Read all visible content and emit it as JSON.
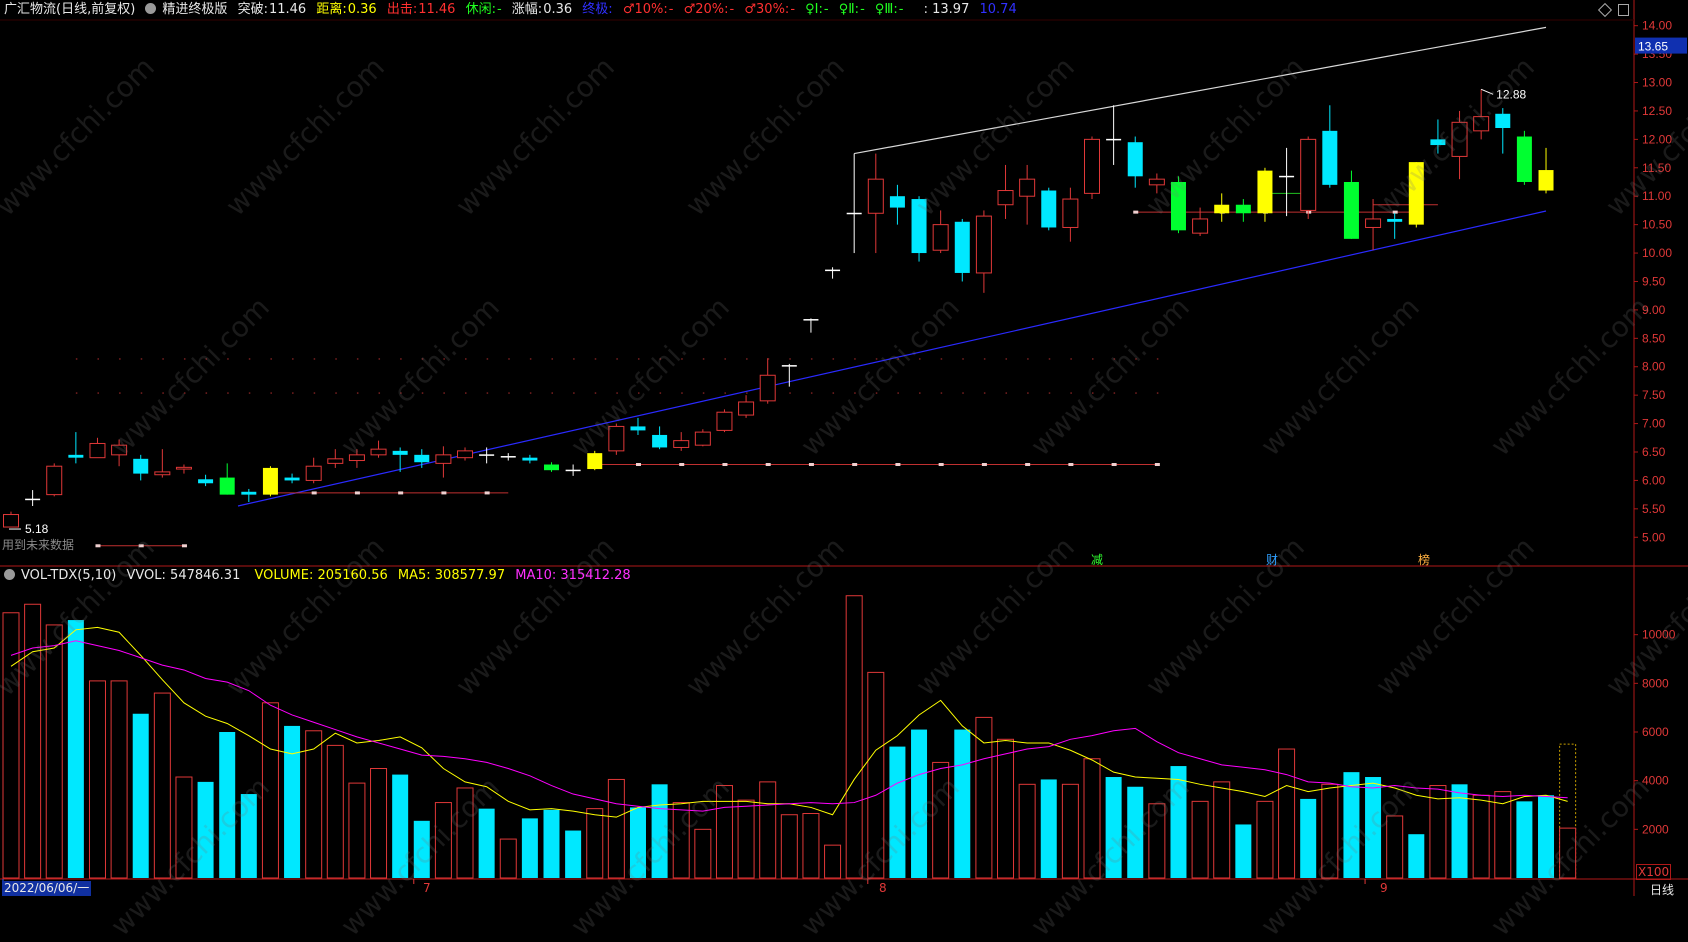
{
  "header": {
    "stock_title": "广汇物流(日线,前复权)",
    "indicator_name": "精进终极版",
    "tupo_label": "突破:",
    "tupo_value": "11.46",
    "juli_label": "距离:",
    "juli_value": "0.36",
    "chuji_label": "出击:",
    "chuji_value": "11.46",
    "xiuxian_label": "休闲:",
    "xiuxian_value": "-",
    "zhangfu_label": "涨幅:",
    "zhangfu_value": "0.36",
    "zhongji_label": "终极:",
    "p10_label": "♂10%:",
    "p10_value": "-",
    "p20_label": "♂20%:",
    "p20_value": "-",
    "p30_label": "♂30%:",
    "p30_value": "-",
    "q1_label": "♀Ⅰ:",
    "q1_value": "-",
    "q2_label": "♀Ⅱ:",
    "q2_value": "-",
    "q3_label": "♀Ⅲ:",
    "q3_value": "-",
    "v1": ": 13.97",
    "v2": "10.74"
  },
  "volume_header": {
    "name": "VOL-TDX(5,10)",
    "vvol": "VVOL: 547846.31",
    "volume": "VOLUME: 205160.56",
    "ma5": "MA5: 308577.97",
    "ma10": "MA10: 315412.28"
  },
  "colors": {
    "up": "#e03838",
    "down": "#00e8ff",
    "yellow": "#ffff00",
    "green": "#00ff30",
    "white": "#ffffff",
    "blue": "#2020ff",
    "magenta": "#ff00ff",
    "axis": "#b01818"
  },
  "watermark": "www.cfchi.com",
  "future_data_text": "用到未来数据",
  "event_markers": [
    "减",
    "财",
    "榜"
  ],
  "bottom_axis": {
    "start_date": "2022/06/06/一",
    "months": [
      "7",
      "8",
      "9"
    ],
    "period": "日线"
  },
  "volume_unit": "X100",
  "chart_data": [
    {
      "type": "candlestick",
      "title": "广汇物流(日线,前复权)",
      "y_ticks": [
        "14.00",
        "13.50",
        "13.00",
        "12.50",
        "12.00",
        "11.50",
        "11.00",
        "10.50",
        "10.00",
        "9.50",
        "9.00",
        "8.50",
        "8.00",
        "7.50",
        "7.00",
        "6.50",
        "6.00",
        "5.50",
        "5.00"
      ],
      "ylim": [
        4.6,
        14.1
      ],
      "current_price_label": "13.65",
      "annotations": [
        {
          "text": "12.88",
          "kind": "high"
        },
        {
          "text": "5.18",
          "kind": "low"
        }
      ],
      "candles": [
        {
          "o": 5.18,
          "h": 5.45,
          "l": 5.18,
          "c": 5.4,
          "t": "up"
        },
        {
          "o": 5.67,
          "h": 5.83,
          "l": 5.55,
          "c": 5.66,
          "t": "doji"
        },
        {
          "o": 5.75,
          "h": 6.3,
          "l": 5.72,
          "c": 6.25,
          "t": "up"
        },
        {
          "o": 6.45,
          "h": 6.85,
          "l": 6.3,
          "c": 6.4,
          "t": "down"
        },
        {
          "o": 6.4,
          "h": 6.75,
          "l": 6.4,
          "c": 6.65,
          "t": "up"
        },
        {
          "o": 6.62,
          "h": 6.72,
          "l": 6.25,
          "c": 6.45,
          "t": "up"
        },
        {
          "o": 6.38,
          "h": 6.45,
          "l": 6.0,
          "c": 6.12,
          "t": "down"
        },
        {
          "o": 6.1,
          "h": 6.55,
          "l": 6.05,
          "c": 6.15,
          "t": "up"
        },
        {
          "o": 6.2,
          "h": 6.28,
          "l": 6.12,
          "c": 6.23,
          "t": "up"
        },
        {
          "o": 6.02,
          "h": 6.1,
          "l": 5.9,
          "c": 5.95,
          "t": "down"
        },
        {
          "o": 6.05,
          "h": 6.3,
          "l": 5.75,
          "c": 5.75,
          "t": "green"
        },
        {
          "o": 5.8,
          "h": 5.85,
          "l": 5.62,
          "c": 5.75,
          "t": "down"
        },
        {
          "o": 5.75,
          "h": 6.25,
          "l": 5.72,
          "c": 6.22,
          "t": "yellow"
        },
        {
          "o": 6.05,
          "h": 6.12,
          "l": 5.95,
          "c": 6.0,
          "t": "down"
        },
        {
          "o": 6.0,
          "h": 6.4,
          "l": 5.95,
          "c": 6.25,
          "t": "up"
        },
        {
          "o": 6.3,
          "h": 6.55,
          "l": 6.22,
          "c": 6.38,
          "t": "up"
        },
        {
          "o": 6.35,
          "h": 6.55,
          "l": 6.22,
          "c": 6.45,
          "t": "up"
        },
        {
          "o": 6.45,
          "h": 6.7,
          "l": 6.4,
          "c": 6.55,
          "t": "up"
        },
        {
          "o": 6.52,
          "h": 6.58,
          "l": 6.15,
          "c": 6.45,
          "t": "down"
        },
        {
          "o": 6.45,
          "h": 6.55,
          "l": 6.22,
          "c": 6.32,
          "t": "down"
        },
        {
          "o": 6.3,
          "h": 6.6,
          "l": 6.05,
          "c": 6.45,
          "t": "up"
        },
        {
          "o": 6.4,
          "h": 6.58,
          "l": 6.35,
          "c": 6.52,
          "t": "up"
        },
        {
          "o": 6.45,
          "h": 6.58,
          "l": 6.3,
          "c": 6.45,
          "t": "doji"
        },
        {
          "o": 6.42,
          "h": 6.48,
          "l": 6.35,
          "c": 6.42,
          "t": "doji"
        },
        {
          "o": 6.4,
          "h": 6.45,
          "l": 6.3,
          "c": 6.35,
          "t": "down"
        },
        {
          "o": 6.28,
          "h": 6.32,
          "l": 6.15,
          "c": 6.18,
          "t": "green"
        },
        {
          "o": 6.18,
          "h": 6.28,
          "l": 6.08,
          "c": 6.18,
          "t": "doji"
        },
        {
          "o": 6.2,
          "h": 6.52,
          "l": 6.18,
          "c": 6.48,
          "t": "yellow"
        },
        {
          "o": 6.52,
          "h": 7.0,
          "l": 6.45,
          "c": 6.95,
          "t": "up"
        },
        {
          "o": 6.95,
          "h": 7.1,
          "l": 6.8,
          "c": 6.88,
          "t": "down"
        },
        {
          "o": 6.8,
          "h": 6.95,
          "l": 6.55,
          "c": 6.58,
          "t": "down"
        },
        {
          "o": 6.58,
          "h": 6.85,
          "l": 6.52,
          "c": 6.7,
          "t": "up"
        },
        {
          "o": 6.62,
          "h": 6.9,
          "l": 6.6,
          "c": 6.85,
          "t": "up"
        },
        {
          "o": 6.88,
          "h": 7.25,
          "l": 6.85,
          "c": 7.2,
          "t": "up"
        },
        {
          "o": 7.15,
          "h": 7.5,
          "l": 7.1,
          "c": 7.38,
          "t": "up"
        },
        {
          "o": 7.4,
          "h": 8.15,
          "l": 7.35,
          "c": 7.85,
          "t": "up"
        },
        {
          "o": 8.02,
          "h": 8.05,
          "l": 7.65,
          "c": 8.02,
          "t": "doji"
        },
        {
          "o": 8.83,
          "h": 8.85,
          "l": 8.6,
          "c": 8.83,
          "t": "doji"
        },
        {
          "o": 9.7,
          "h": 9.75,
          "l": 9.55,
          "c": 9.7,
          "t": "doji"
        },
        {
          "o": 10.7,
          "h": 11.75,
          "l": 10.0,
          "c": 10.7,
          "t": "doji"
        },
        {
          "o": 10.7,
          "h": 11.75,
          "l": 10.0,
          "c": 11.3,
          "t": "up"
        },
        {
          "o": 11.0,
          "h": 11.2,
          "l": 10.5,
          "c": 10.8,
          "t": "down"
        },
        {
          "o": 10.95,
          "h": 11.0,
          "l": 9.85,
          "c": 10.0,
          "t": "down"
        },
        {
          "o": 10.05,
          "h": 10.75,
          "l": 10.0,
          "c": 10.5,
          "t": "up"
        },
        {
          "o": 10.55,
          "h": 10.6,
          "l": 9.5,
          "c": 9.65,
          "t": "down"
        },
        {
          "o": 9.65,
          "h": 10.75,
          "l": 9.3,
          "c": 10.65,
          "t": "up"
        },
        {
          "o": 10.85,
          "h": 11.55,
          "l": 10.6,
          "c": 11.1,
          "t": "up"
        },
        {
          "o": 11.0,
          "h": 11.55,
          "l": 10.5,
          "c": 11.3,
          "t": "up"
        },
        {
          "o": 11.1,
          "h": 11.15,
          "l": 10.4,
          "c": 10.45,
          "t": "down"
        },
        {
          "o": 10.45,
          "h": 11.15,
          "l": 10.2,
          "c": 10.95,
          "t": "up"
        },
        {
          "o": 11.05,
          "h": 12.05,
          "l": 10.95,
          "c": 12.0,
          "t": "up"
        },
        {
          "o": 12.0,
          "h": 12.6,
          "l": 11.55,
          "c": 12.0,
          "t": "doji"
        },
        {
          "o": 11.95,
          "h": 12.05,
          "l": 11.15,
          "c": 11.35,
          "t": "down"
        },
        {
          "o": 11.2,
          "h": 11.4,
          "l": 11.05,
          "c": 11.3,
          "t": "up"
        },
        {
          "o": 11.25,
          "h": 11.35,
          "l": 10.35,
          "c": 10.4,
          "t": "green"
        },
        {
          "o": 10.35,
          "h": 10.8,
          "l": 10.3,
          "c": 10.6,
          "t": "up"
        },
        {
          "o": 10.7,
          "h": 11.05,
          "l": 10.55,
          "c": 10.85,
          "t": "yellow"
        },
        {
          "o": 10.85,
          "h": 10.95,
          "l": 10.55,
          "c": 10.7,
          "t": "green"
        },
        {
          "o": 10.7,
          "h": 11.5,
          "l": 10.55,
          "c": 11.45,
          "t": "yellow"
        },
        {
          "o": 11.35,
          "h": 11.85,
          "l": 10.65,
          "c": 11.35,
          "t": "doji"
        },
        {
          "o": 10.75,
          "h": 12.05,
          "l": 10.6,
          "c": 12.0,
          "t": "up"
        },
        {
          "o": 12.15,
          "h": 12.6,
          "l": 11.15,
          "c": 11.2,
          "t": "down"
        },
        {
          "o": 11.25,
          "h": 11.45,
          "l": 10.25,
          "c": 10.25,
          "t": "green"
        },
        {
          "o": 10.45,
          "h": 10.95,
          "l": 10.05,
          "c": 10.6,
          "t": "up"
        },
        {
          "o": 10.6,
          "h": 10.7,
          "l": 10.25,
          "c": 10.55,
          "t": "down"
        },
        {
          "o": 10.5,
          "h": 11.6,
          "l": 10.45,
          "c": 11.6,
          "t": "yellow"
        },
        {
          "o": 12.0,
          "h": 12.35,
          "l": 11.75,
          "c": 11.9,
          "t": "down"
        },
        {
          "o": 11.7,
          "h": 12.5,
          "l": 11.3,
          "c": 12.3,
          "t": "up"
        },
        {
          "o": 12.15,
          "h": 12.88,
          "l": 12.0,
          "c": 12.4,
          "t": "up"
        },
        {
          "o": 12.45,
          "h": 12.55,
          "l": 11.75,
          "c": 12.2,
          "t": "down"
        },
        {
          "o": 12.05,
          "h": 12.15,
          "l": 11.2,
          "c": 11.25,
          "t": "green"
        },
        {
          "o": 11.1,
          "h": 11.85,
          "l": 11.05,
          "c": 11.46,
          "t": "yellow"
        }
      ]
    },
    {
      "type": "bar+line",
      "title": "VOL-TDX(5,10)",
      "y_ticks": [
        "10000",
        "8000",
        "6000",
        "4000",
        "2000"
      ],
      "ylim": [
        0,
        12000
      ],
      "volumes": [
        {
          "v": 10900,
          "t": "up"
        },
        {
          "v": 11250,
          "t": "up"
        },
        {
          "v": 10400,
          "t": "up"
        },
        {
          "v": 10600,
          "t": "down"
        },
        {
          "v": 8100,
          "t": "up"
        },
        {
          "v": 8100,
          "t": "up"
        },
        {
          "v": 6750,
          "t": "down"
        },
        {
          "v": 7600,
          "t": "up"
        },
        {
          "v": 4150,
          "t": "up"
        },
        {
          "v": 3950,
          "t": "down"
        },
        {
          "v": 6000,
          "t": "down"
        },
        {
          "v": 3450,
          "t": "down"
        },
        {
          "v": 7200,
          "t": "up"
        },
        {
          "v": 6250,
          "t": "down"
        },
        {
          "v": 6050,
          "t": "up"
        },
        {
          "v": 5450,
          "t": "up"
        },
        {
          "v": 3900,
          "t": "up"
        },
        {
          "v": 4500,
          "t": "up"
        },
        {
          "v": 4250,
          "t": "down"
        },
        {
          "v": 2350,
          "t": "down"
        },
        {
          "v": 3100,
          "t": "up"
        },
        {
          "v": 3700,
          "t": "up"
        },
        {
          "v": 2850,
          "t": "down"
        },
        {
          "v": 1600,
          "t": "up"
        },
        {
          "v": 2450,
          "t": "down"
        },
        {
          "v": 2800,
          "t": "down"
        },
        {
          "v": 1950,
          "t": "down"
        },
        {
          "v": 2850,
          "t": "up"
        },
        {
          "v": 4050,
          "t": "up"
        },
        {
          "v": 2900,
          "t": "down"
        },
        {
          "v": 3850,
          "t": "down"
        },
        {
          "v": 3100,
          "t": "up"
        },
        {
          "v": 2000,
          "t": "up"
        },
        {
          "v": 3800,
          "t": "up"
        },
        {
          "v": 3200,
          "t": "up"
        },
        {
          "v": 3950,
          "t": "up"
        },
        {
          "v": 2600,
          "t": "up"
        },
        {
          "v": 2650,
          "t": "up"
        },
        {
          "v": 1350,
          "t": "up"
        },
        {
          "v": 11600,
          "t": "up"
        },
        {
          "v": 8450,
          "t": "up"
        },
        {
          "v": 5400,
          "t": "down"
        },
        {
          "v": 6100,
          "t": "down"
        },
        {
          "v": 4750,
          "t": "up"
        },
        {
          "v": 6100,
          "t": "down"
        },
        {
          "v": 6600,
          "t": "up"
        },
        {
          "v": 5700,
          "t": "up"
        },
        {
          "v": 3850,
          "t": "up"
        },
        {
          "v": 4050,
          "t": "down"
        },
        {
          "v": 3850,
          "t": "up"
        },
        {
          "v": 4900,
          "t": "up"
        },
        {
          "v": 4150,
          "t": "down"
        },
        {
          "v": 3750,
          "t": "down"
        },
        {
          "v": 3050,
          "t": "up"
        },
        {
          "v": 4600,
          "t": "down"
        },
        {
          "v": 3150,
          "t": "up"
        },
        {
          "v": 3950,
          "t": "up"
        },
        {
          "v": 2200,
          "t": "down"
        },
        {
          "v": 3150,
          "t": "up"
        },
        {
          "v": 5300,
          "t": "up"
        },
        {
          "v": 3250,
          "t": "down"
        },
        {
          "v": 3850,
          "t": "up"
        },
        {
          "v": 4350,
          "t": "down"
        },
        {
          "v": 4150,
          "t": "down"
        },
        {
          "v": 2550,
          "t": "up"
        },
        {
          "v": 1800,
          "t": "down"
        },
        {
          "v": 3800,
          "t": "up"
        },
        {
          "v": 3850,
          "t": "down"
        },
        {
          "v": 3400,
          "t": "up"
        },
        {
          "v": 3550,
          "t": "up"
        },
        {
          "v": 3150,
          "t": "down"
        },
        {
          "v": 3400,
          "t": "down"
        },
        {
          "v": 2050,
          "t": "current"
        }
      ],
      "series": [
        {
          "name": "MA5",
          "color": "#ffff00",
          "values": [
            8700,
            9300,
            9450,
            10200,
            10300,
            10100,
            9150,
            8150,
            7200,
            6650,
            6350,
            5850,
            5300,
            5100,
            5300,
            5950,
            5550,
            5650,
            5800,
            5350,
            4500,
            3950,
            3750,
            3150,
            2800,
            2850,
            2750,
            2600,
            2500,
            2900,
            3000,
            3050,
            3150,
            3150,
            3150,
            3050,
            3050,
            2900,
            2600,
            4050,
            5250,
            5850,
            6700,
            7300,
            6250,
            5550,
            5650,
            5550,
            5550,
            5250,
            4850,
            4350,
            4150,
            4100,
            4050,
            3850,
            3700,
            3550,
            3350,
            3800,
            3550,
            3700,
            3800,
            3900,
            3700,
            3400,
            3250,
            3300,
            3200,
            3050,
            3350,
            3400,
            3150
          ]
        },
        {
          "name": "MA10",
          "color": "#ff00ff",
          "values": [
            9150,
            9450,
            9550,
            9750,
            9550,
            9350,
            9050,
            8750,
            8550,
            8200,
            8050,
            7700,
            7100,
            6700,
            6400,
            6100,
            5800,
            5550,
            5300,
            5050,
            5000,
            4900,
            4750,
            4500,
            4200,
            3800,
            3450,
            3250,
            3050,
            2950,
            2850,
            2800,
            2750,
            2900,
            2950,
            3000,
            3050,
            3100,
            3050,
            3100,
            3400,
            3900,
            4250,
            4500,
            4650,
            4900,
            5100,
            5300,
            5400,
            5700,
            5850,
            6050,
            6150,
            5600,
            5150,
            4900,
            4650,
            4550,
            4450,
            4250,
            3950,
            3900,
            3750,
            3700,
            3800,
            3700,
            3650,
            3500,
            3400,
            3350,
            3400,
            3350,
            3300
          ]
        }
      ]
    }
  ]
}
